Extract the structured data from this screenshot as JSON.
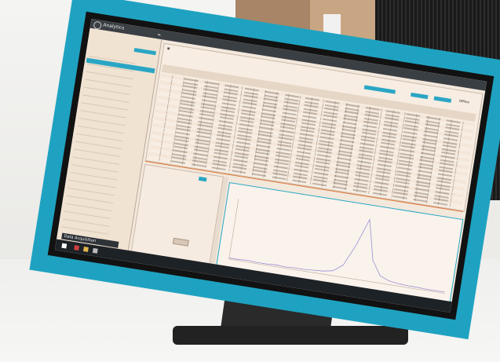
{
  "app": {
    "title": "Analytics",
    "window_label": "Analytics"
  },
  "sidebar": {
    "items": [
      "",
      "",
      "",
      "",
      "",
      "",
      "",
      "",
      "",
      "",
      "",
      "",
      "",
      "",
      "",
      "",
      "",
      "",
      "",
      "",
      "",
      "",
      ""
    ]
  },
  "toolbar": {
    "tabs": [
      "",
      "",
      "",
      "",
      ""
    ],
    "user_label": "Offline"
  },
  "status_bar": {
    "label": "Data Acquisition"
  },
  "chart_data": {
    "type": "line",
    "title": "",
    "xlabel": "",
    "ylabel": "",
    "series": [
      {
        "values": [
          0.02,
          0.02,
          0.03,
          0.02,
          0.02,
          0.03,
          0.02,
          0.03,
          0.03,
          0.04,
          0.05,
          0.08,
          0.2,
          0.55,
          1.0,
          0.35,
          0.12,
          0.06,
          0.04,
          0.03,
          0.03,
          0.02,
          0.02,
          0.02
        ]
      }
    ]
  },
  "colors": {
    "accent": "#2aa6c4",
    "frame": "#1fa2c1",
    "peak_line": "#9b8fd6",
    "separator": "#e27a3a"
  }
}
